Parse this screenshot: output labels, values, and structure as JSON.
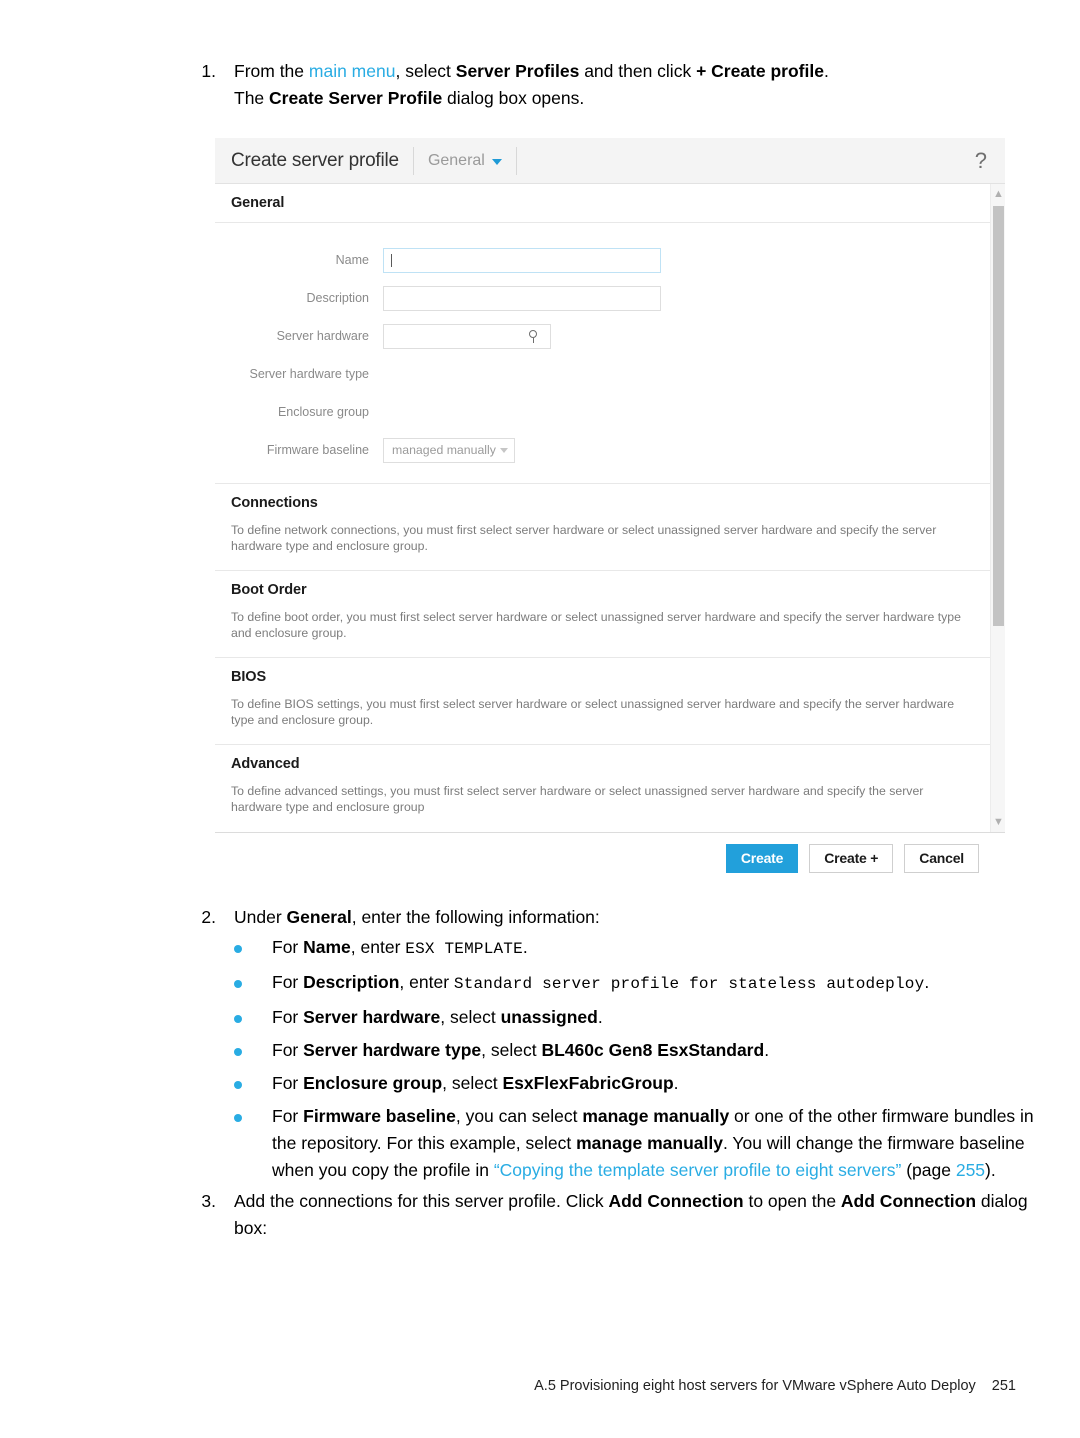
{
  "steps": {
    "step1": {
      "number": "1.",
      "line1_a": "From the ",
      "line1_link": "main menu",
      "line1_b": ", select ",
      "line1_bold1": "Server Profiles",
      "line1_c": " and then click ",
      "line1_bold2": "+ Create profile",
      "line1_d": ".",
      "line2_a": "The ",
      "line2_bold": "Create Server Profile",
      "line2_b": " dialog box opens."
    },
    "step2": {
      "number": "2.",
      "intro_a": "Under ",
      "intro_bold": "General",
      "intro_b": ", enter the following information:",
      "bullets": [
        {
          "a": "For ",
          "bold": "Name",
          "b": ", enter ",
          "mono": "ESX TEMPLATE",
          "c": "."
        },
        {
          "a": "For ",
          "bold": "Description",
          "b": ", enter ",
          "mono": "Standard server profile for stateless autodeploy",
          "c": "."
        },
        {
          "a": "For ",
          "bold": "Server hardware",
          "b": ", select ",
          "bold2": "unassigned",
          "c": "."
        },
        {
          "a": "For ",
          "bold": "Server hardware type",
          "b": ", select ",
          "bold2": "BL460c Gen8 EsxStandard",
          "c": "."
        },
        {
          "a": "For ",
          "bold": "Enclosure group",
          "b": ", select ",
          "bold2": "EsxFlexFabricGroup",
          "c": "."
        }
      ],
      "firmware_bullet": {
        "a": "For ",
        "bold": "Firmware baseline",
        "b": ", you can select ",
        "bold2": "manage manually",
        "c": " or one of the other firmware bundles in the repository. For this example, select ",
        "bold3": "manage manually",
        "d": ". You will change the firmware baseline when you copy the profile in ",
        "link": "“Copying the template server profile to eight servers”",
        "e": " (page ",
        "link_page": "255",
        "f": ")."
      }
    },
    "step3": {
      "number": "3.",
      "a": "Add the connections for this server profile. Click ",
      "bold1": "Add Connection",
      "b": " to open the ",
      "bold2": "Add Connection",
      "c": " dialog box:"
    }
  },
  "dialog": {
    "title": "Create server profile",
    "breadcrumb": "General",
    "help_icon": "?",
    "sections": {
      "general": {
        "heading": "General",
        "fields": {
          "name": {
            "label": "Name",
            "value": "",
            "placeholder": ""
          },
          "description": {
            "label": "Description",
            "value": "",
            "placeholder": ""
          },
          "server_hardware": {
            "label": "Server hardware",
            "value": "",
            "placeholder": ""
          },
          "server_hardware_type": {
            "label": "Server hardware type",
            "value": ""
          },
          "enclosure_group": {
            "label": "Enclosure group",
            "value": ""
          },
          "firmware_baseline": {
            "label": "Firmware baseline",
            "value": "managed manually"
          }
        }
      },
      "connections": {
        "heading": "Connections",
        "text": "To define network connections, you must first select server hardware or select unassigned server hardware and specify the server hardware type and enclosure group."
      },
      "boot_order": {
        "heading": "Boot Order",
        "text": "To define boot order, you must first select server hardware or select unassigned server hardware and specify the server hardware type and enclosure group."
      },
      "bios": {
        "heading": "BIOS",
        "text": "To define BIOS settings, you must first select server hardware or select unassigned server hardware and specify the server hardware type and enclosure group."
      },
      "advanced": {
        "heading": "Advanced",
        "text": "To define advanced settings, you must first select server hardware or select unassigned server hardware and specify the server hardware type and enclosure group"
      }
    },
    "buttons": {
      "create": "Create",
      "create_plus": "Create +",
      "cancel": "Cancel"
    },
    "colors": {
      "primary": "#22a0db",
      "link": "#29ace3"
    }
  },
  "footer": {
    "text": "A.5 Provisioning eight host servers for VMware vSphere Auto Deploy",
    "page_number": "251"
  }
}
